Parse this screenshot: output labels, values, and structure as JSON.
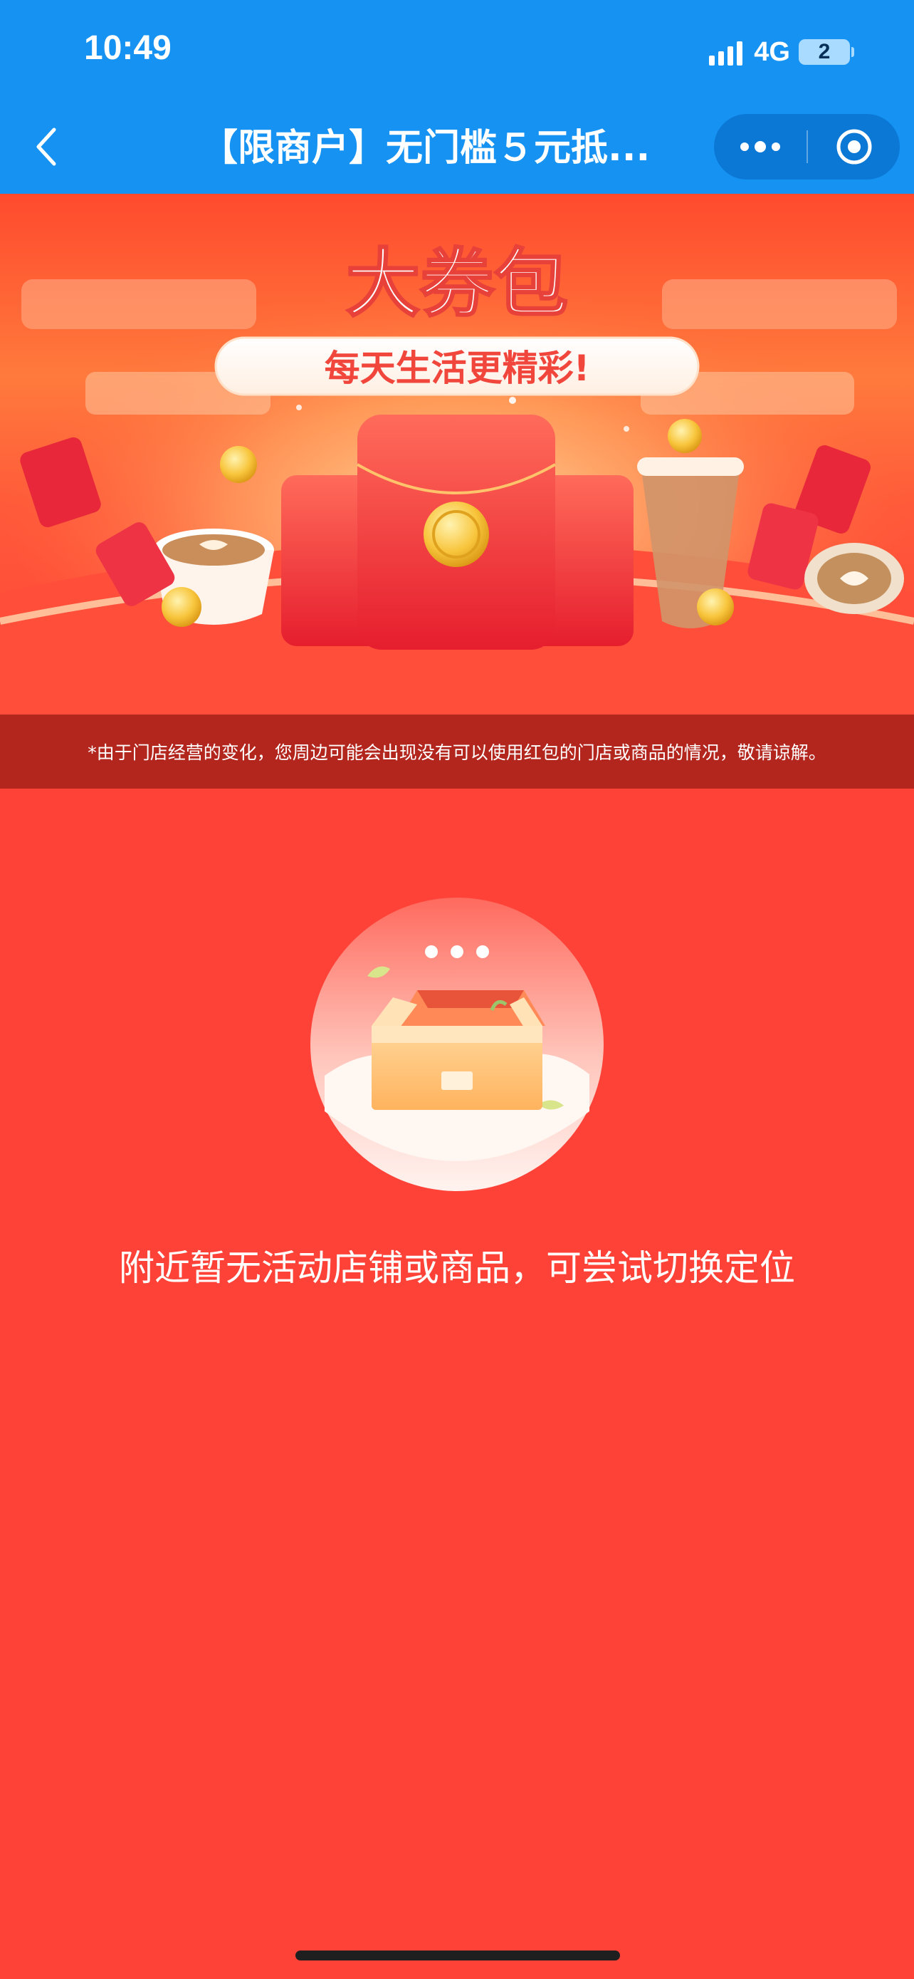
{
  "status_bar": {
    "time": "10:49",
    "network": "4G",
    "battery": "2"
  },
  "nav": {
    "title": "【限商户】无门槛５元抵...",
    "back_icon": "chevron-left-icon",
    "more_icon": "more-dots-icon",
    "close_icon": "target-close-icon"
  },
  "banner": {
    "title": "大券包",
    "subtitle": "每天生活更精彩!"
  },
  "notice": {
    "text": "*由于门店经营的变化，您周边可能会出现没有可以使用红包的门店或商品的情况，敬请谅解。"
  },
  "empty_state": {
    "message": "附近暂无活动店铺或商品，可尝试切换定位",
    "icon": "empty-box-icon"
  },
  "colors": {
    "header": "#1592F2",
    "background": "#FF4237",
    "notice_bar": "#B3261D"
  }
}
